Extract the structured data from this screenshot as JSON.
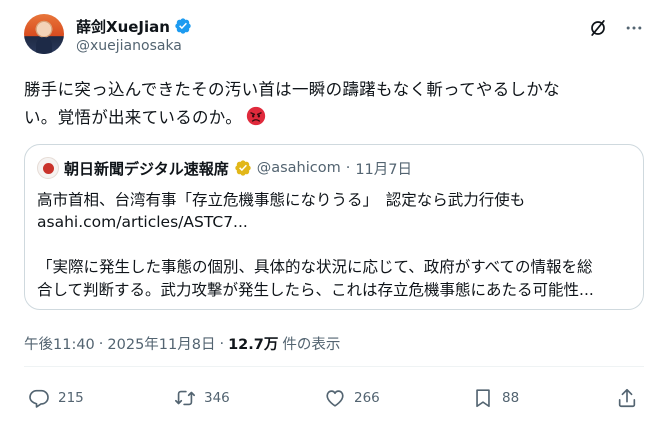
{
  "author": {
    "display_name": "薛剑XueJian",
    "handle": "@xuejianosaka",
    "verified": true,
    "verified_color": "#1d9bf0"
  },
  "tweet": {
    "line1": "勝手に突っ込んできたその汚い首は一瞬の躊躇もなく斬ってやるしかな",
    "line2": "い。覚悟が出来ているのか。",
    "emoji": "angry-face"
  },
  "quote": {
    "name": "朝日新聞デジタル速報席",
    "badge_color": "#e2b719",
    "handle": "@asahicom",
    "separator": "·",
    "date": "11月7日",
    "headline": "高市首相、台湾有事「存立危機事態になりうる」　認定なら武力行使も",
    "link": "asahi.com/articles/ASTC7...",
    "body1": "「実際に発生した事態の個別、具体的な状況に応じて、政府がすべての情報を総",
    "body2": "合して判断する。武力攻撃が発生したら、これは存立危機事態にあたる可能性..."
  },
  "meta": {
    "time": "午後11:40",
    "separator": "·",
    "date": "2025年11月8日",
    "separator2": "·",
    "views": "12.7万",
    "views_label": "件の表示"
  },
  "actions": {
    "reply_count": "215",
    "retweet_count": "346",
    "like_count": "266",
    "bookmark_count": "88"
  }
}
